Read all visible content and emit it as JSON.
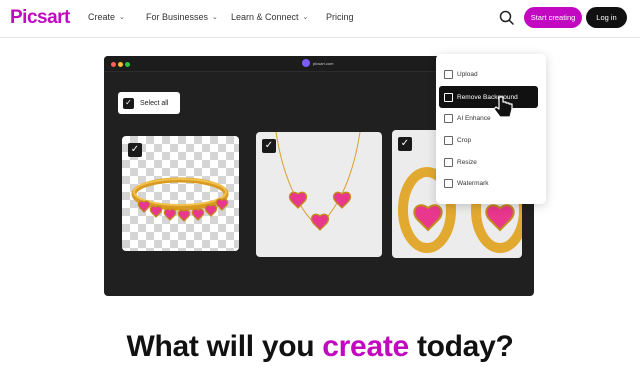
{
  "brand": {
    "name": "Picsart",
    "color": "#c209c1"
  },
  "nav": {
    "items": [
      {
        "label": "Create",
        "has_chevron": true
      },
      {
        "label": "For Businesses",
        "has_chevron": true
      },
      {
        "label": "Learn & Connect",
        "has_chevron": true
      },
      {
        "label": "Pricing",
        "has_chevron": false
      }
    ],
    "search_icon": "search-icon",
    "start_label": "Start creating",
    "login_label": "Log in"
  },
  "app": {
    "title": "picsart.com",
    "select_all_label": "Select all",
    "cards": [
      {
        "name": "ring",
        "background": "transparent-checker",
        "checked": true
      },
      {
        "name": "necklace",
        "background": "light-gray",
        "checked": true
      },
      {
        "name": "earrings",
        "background": "light-gray",
        "checked": true
      }
    ],
    "menu": [
      {
        "label": "Upload",
        "icon": "upload-icon"
      },
      {
        "label": "Remove Background",
        "icon": "remove-bg-icon",
        "active": true
      },
      {
        "label": "AI Enhance",
        "icon": "enhance-icon"
      },
      {
        "label": "Crop",
        "icon": "crop-icon"
      },
      {
        "label": "Resize",
        "icon": "resize-icon"
      },
      {
        "label": "Watermark",
        "icon": "watermark-icon"
      }
    ]
  },
  "headline": {
    "prefix": "What will you ",
    "accent": "create",
    "suffix": " today?"
  },
  "colors": {
    "accent": "#c209c1",
    "app_bg": "#1f201f",
    "gold": "#e7b23a",
    "pink": "#e8378d"
  }
}
